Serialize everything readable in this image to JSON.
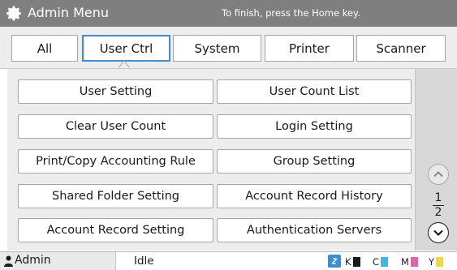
{
  "titlebar": {
    "title": "Admin Menu",
    "hint": "To finish, press the Home key.",
    "icon": "gear-icon"
  },
  "tabs": [
    {
      "label": "All",
      "active": false
    },
    {
      "label": "User Ctrl",
      "active": true
    },
    {
      "label": "System",
      "active": false
    },
    {
      "label": "Printer",
      "active": false
    },
    {
      "label": "Scanner",
      "active": false
    }
  ],
  "buttons": [
    {
      "label": "User Setting"
    },
    {
      "label": "User Count List"
    },
    {
      "label": "Clear User Count"
    },
    {
      "label": "Login Setting"
    },
    {
      "label": "Print/Copy Accounting Rule"
    },
    {
      "label": "Group Setting"
    },
    {
      "label": "Shared Folder Setting"
    },
    {
      "label": "Account Record History"
    },
    {
      "label": "Account Record Setting"
    },
    {
      "label": "Authentication Servers"
    }
  ],
  "pager": {
    "current": "1",
    "total": "2"
  },
  "status": {
    "user": "Admin",
    "state": "Idle",
    "ink": [
      {
        "letter": "K",
        "color": "#1a1a1a"
      },
      {
        "letter": "C",
        "color": "#3fb6e6"
      },
      {
        "letter": "M",
        "color": "#d86aa8"
      },
      {
        "letter": "Y",
        "color": "#f2d63a"
      }
    ]
  },
  "colors": {
    "titlebar": "#807f80",
    "active_tab_border": "#3b8fd1",
    "link_icon": "#3b8fd1"
  }
}
